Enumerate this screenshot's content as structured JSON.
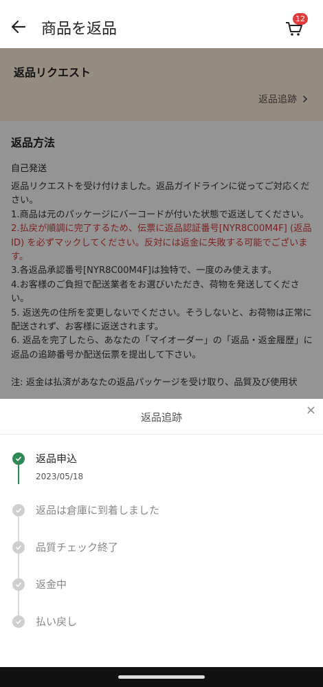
{
  "header": {
    "title": "商品を返品",
    "cart_badge": "12"
  },
  "request": {
    "title": "返品リクエスト",
    "tracking_link": "返品追跡"
  },
  "method": {
    "title": "返品方法",
    "subtitle": "自己発送",
    "p1": "返品リクエストを受け付けました。返品ガイドラインに従ってご対応ください。",
    "p2": "1.商品は元のパッケージにバーコードが付いた状態で返送してください。",
    "p3": "2.払戻が順調に完了するため、伝票に返品認証番号[NYR8C00M4F] (返品 ID) を必ずマックしてください。反対には返金に失敗する可能でございます。",
    "p4": "3.各返品承認番号[NYR8C00M4F]は独特で、一度のみ使えます。",
    "p5": "4.お客様のご負担で配送業者をお選びいただき、荷物を発送してください。",
    "p6": "5. 返送先の住所を変更しないでください。そうしないと、お荷物は正常に配送されず、お客様に返送されます。",
    "p7": "6. 返品を完了したら、あなたの「マイオーダー」の「返品・返金履歴」に返品の追跡番号か配送伝票を提出して下さい。",
    "p8": "注: 返金は払済があなたの返品パッケージを受け取り、品質及び使用状"
  },
  "sheet": {
    "title": "返品追跡",
    "close": "×",
    "steps": [
      {
        "label": "返品申込",
        "date": "2023/05/18"
      },
      {
        "label": "返品は倉庫に到着しました"
      },
      {
        "label": "品質チェック終了"
      },
      {
        "label": "返金中"
      },
      {
        "label": "払い戻し"
      }
    ]
  },
  "colors": {
    "accent_green": "#2e8b57",
    "badge_red": "#e23b3b",
    "warning_red": "#d43b3b"
  }
}
